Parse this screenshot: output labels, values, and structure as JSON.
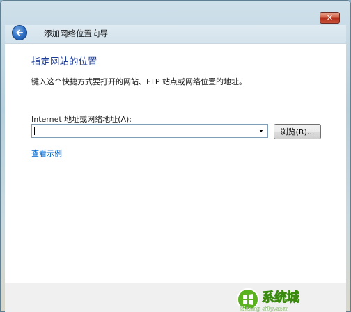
{
  "window": {
    "close_glyph": "✕"
  },
  "header": {
    "title": "添加网络位置向导",
    "back_icon": "back-arrow-icon"
  },
  "content": {
    "main_instruction": "指定网站的位置",
    "description": "键入这个快捷方式要打开的网站、FTP 站点或网络位置的地址。",
    "address_label": "Internet 地址或网络地址(A):",
    "address_value": "",
    "browse_label": "浏览(R)...",
    "example_link": "查看示例"
  },
  "watermark": {
    "brand_cn": "系统城",
    "brand_en": "Xitong city.com"
  },
  "colors": {
    "instruction_blue": "#1e3c96",
    "link_blue": "#0066cc",
    "close_red": "#c8503a",
    "watermark_green": "#5ab31e"
  }
}
